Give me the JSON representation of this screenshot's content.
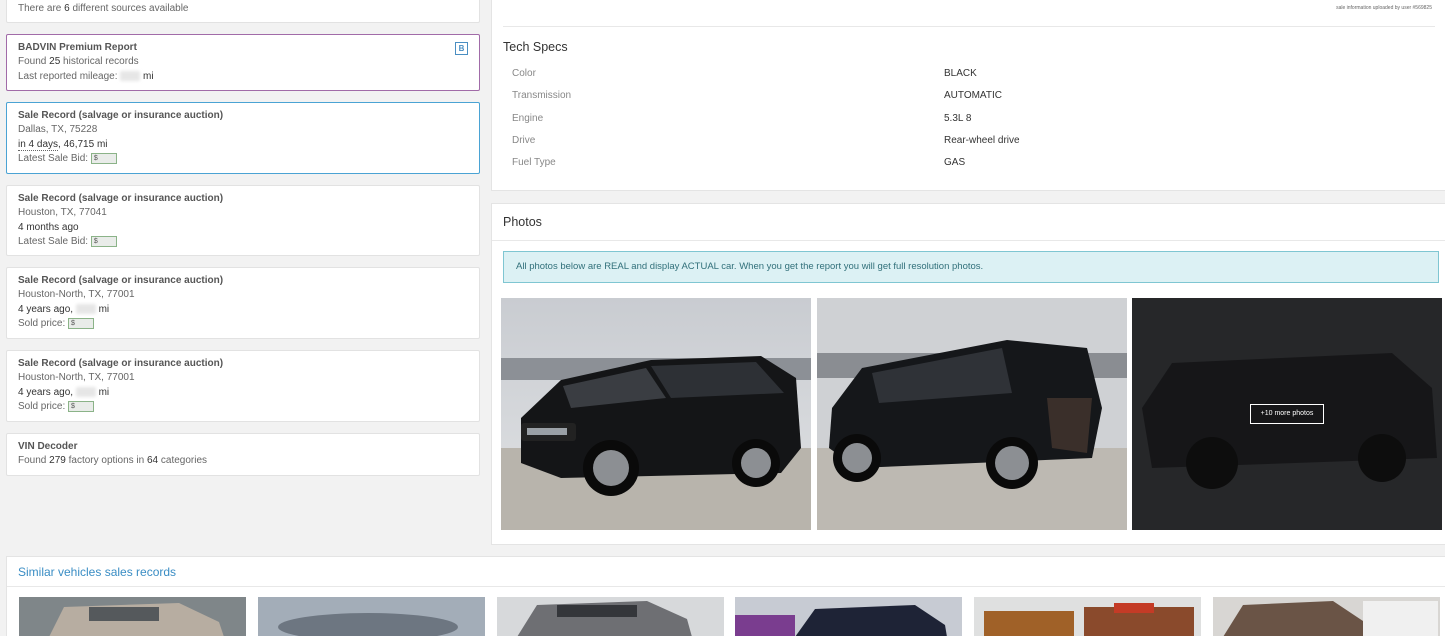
{
  "sources": {
    "prefix": "There are ",
    "count": "6",
    "suffix": " different sources available"
  },
  "premium": {
    "title": "BADVIN Premium Report",
    "badge": "B",
    "found_prefix": "Found ",
    "found_count": "25",
    "found_suffix": " historical records",
    "mileage_label": "Last reported mileage: ",
    "mileage_unit": " mi"
  },
  "records": [
    {
      "title": "Sale Record (salvage or insurance auction)",
      "location": "Dallas, TX, 75228",
      "when": "in 4 days",
      "mileage": ", 46,715 mi",
      "price_label": "Latest Sale Bid: ",
      "currency": "$"
    },
    {
      "title": "Sale Record (salvage or insurance auction)",
      "location": "Houston, TX, 77041",
      "when": "4 months ago",
      "price_label": "Latest Sale Bid: ",
      "currency": "$"
    },
    {
      "title": "Sale Record (salvage or insurance auction)",
      "location": "Houston-North, TX, 77001",
      "when": "4 years ago,",
      "mileage_unit": " mi",
      "price_label": "Sold price: ",
      "currency": "$"
    },
    {
      "title": "Sale Record (salvage or insurance auction)",
      "location": "Houston-North, TX, 77001",
      "when": "4 years ago,",
      "mileage_unit": " mi",
      "price_label": "Sold price: ",
      "currency": "$"
    }
  ],
  "vin_decoder": {
    "title": "VIN Decoder",
    "found_prefix": "Found ",
    "options": "279",
    "middle": " factory options in ",
    "categories": "64",
    "suffix": " categories"
  },
  "upload_note": "sale information uploaded by user #569825",
  "tech_specs": {
    "title": "Tech Specs",
    "rows": [
      {
        "label": "Color",
        "value": "BLACK"
      },
      {
        "label": "Transmission",
        "value": "AUTOMATIC"
      },
      {
        "label": "Engine",
        "value": "5.3L 8"
      },
      {
        "label": "Drive",
        "value": "Rear-wheel drive"
      },
      {
        "label": "Fuel Type",
        "value": "GAS"
      }
    ]
  },
  "photos": {
    "title": "Photos",
    "notice": "All photos below are REAL and display ACTUAL car. When you get the report you will get full resolution photos.",
    "more_label": "+10 more photos"
  },
  "similar": {
    "title": "Similar vehicles sales records"
  },
  "colors": {
    "accent_blue": "#4aa3d4",
    "premium_purple": "#a16ba8",
    "notice_bg": "#dcf1f4",
    "link": "#3a8dc4"
  }
}
